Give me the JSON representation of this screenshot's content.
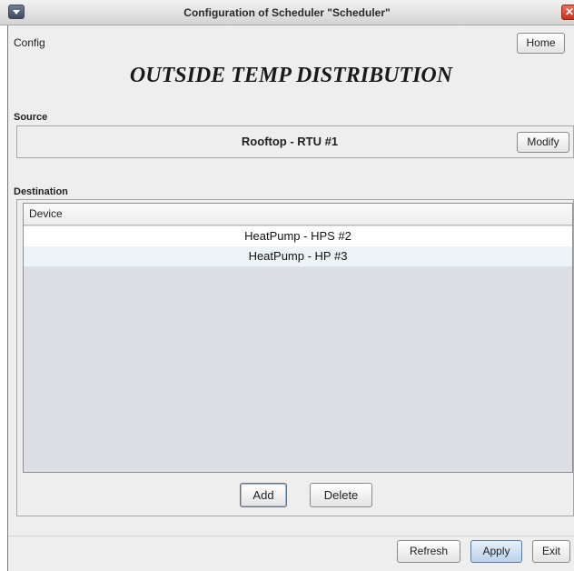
{
  "window": {
    "title": "Configuration of Scheduler \"Scheduler\"",
    "close_glyph": "✕"
  },
  "menu": {
    "config_label": "Config",
    "home_label": "Home"
  },
  "page": {
    "title": "OUTSIDE TEMP DISTRIBUTION"
  },
  "source": {
    "label": "Source",
    "device": "Rooftop - RTU #1",
    "modify_label": "Modify"
  },
  "destination": {
    "label": "Destination",
    "column_header": "Device",
    "rows": [
      "HeatPump - HPS #2",
      "HeatPump - HP #3"
    ],
    "add_label": "Add",
    "delete_label": "Delete"
  },
  "footer": {
    "refresh_label": "Refresh",
    "apply_label": "Apply",
    "exit_label": "Exit"
  },
  "icons": {
    "system_menu": "chevron-down-icon",
    "close": "close-icon"
  },
  "colors": {
    "close_button": "#d9412a",
    "panel_background": "#eeeeee",
    "table_background": "#dcdfe3"
  }
}
